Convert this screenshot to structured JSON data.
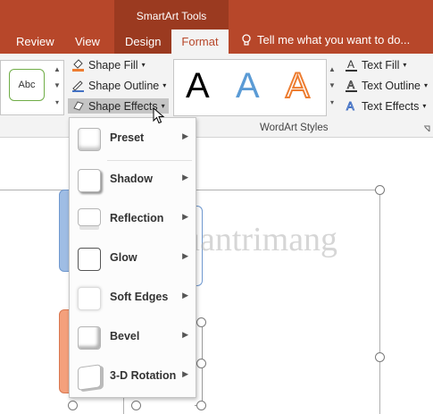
{
  "context_title": "SmartArt Tools",
  "tabs": [
    {
      "label": "Review"
    },
    {
      "label": "View"
    },
    {
      "label": "Design"
    },
    {
      "label": "Format"
    }
  ],
  "tell_me": "Tell me what you want to do...",
  "shape_styles": {
    "gallery_sample": "Abc",
    "shape_fill": "Shape Fill",
    "shape_outline": "Shape Outline",
    "shape_effects": "Shape Effects"
  },
  "wordart": {
    "letters": [
      "A",
      "A",
      "A"
    ],
    "text_fill": "Text Fill",
    "text_outline": "Text Outline",
    "text_effects": "Text Effects",
    "group_label": "WordArt Styles"
  },
  "effects_menu": [
    {
      "label": "Preset",
      "thumb": "preset"
    },
    {
      "label": "Shadow",
      "thumb": "shadow"
    },
    {
      "label": "Reflection",
      "thumb": "reflection"
    },
    {
      "label": "Glow",
      "thumb": "glow"
    },
    {
      "label": "Soft Edges",
      "thumb": "soft-edges"
    },
    {
      "label": "Bevel",
      "thumb": "bevel"
    },
    {
      "label": "3-D Rotation",
      "thumb": "3d-rotation"
    }
  ],
  "watermark": "uantrimang",
  "colors": {
    "ribbon_accent": "#b7472a",
    "context_group": "#9b3a20",
    "wordart_blue": "#5b9bd5",
    "wordart_orange": "#ed7d31"
  }
}
